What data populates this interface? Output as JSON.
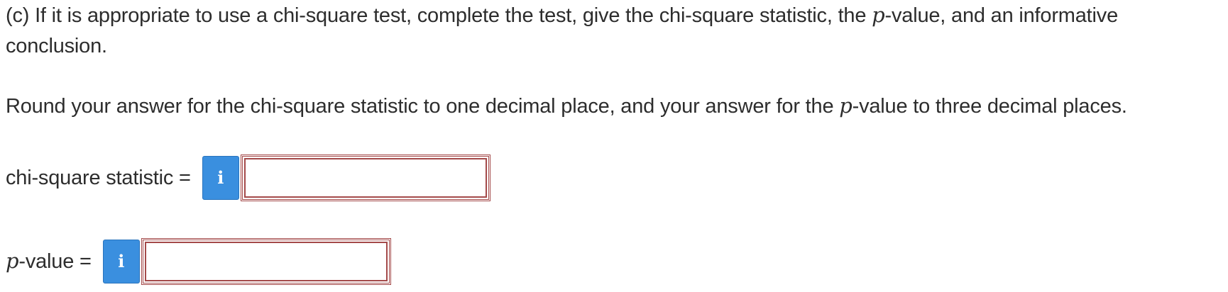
{
  "question": {
    "line1_prefix": "(c) If it is appropriate to use a chi-square test, complete the test, give the chi-square statistic, the ",
    "line1_var": "p",
    "line1_suffix": "-value, and an informative",
    "line2": "conclusion."
  },
  "instruction": {
    "prefix": "Round your answer for the chi-square statistic to one decimal place, and your answer for the ",
    "var": "p",
    "suffix": "-value to three decimal places."
  },
  "answers": {
    "chi_square": {
      "label": "chi-square statistic =",
      "info_icon": "i",
      "value": ""
    },
    "p_value": {
      "label_var": "p",
      "label_suffix": "-value =",
      "info_icon": "i",
      "value": ""
    }
  },
  "colors": {
    "info_button": "#3a8fdf",
    "input_border": "#a44a4a",
    "text": "#2d2d2d"
  }
}
